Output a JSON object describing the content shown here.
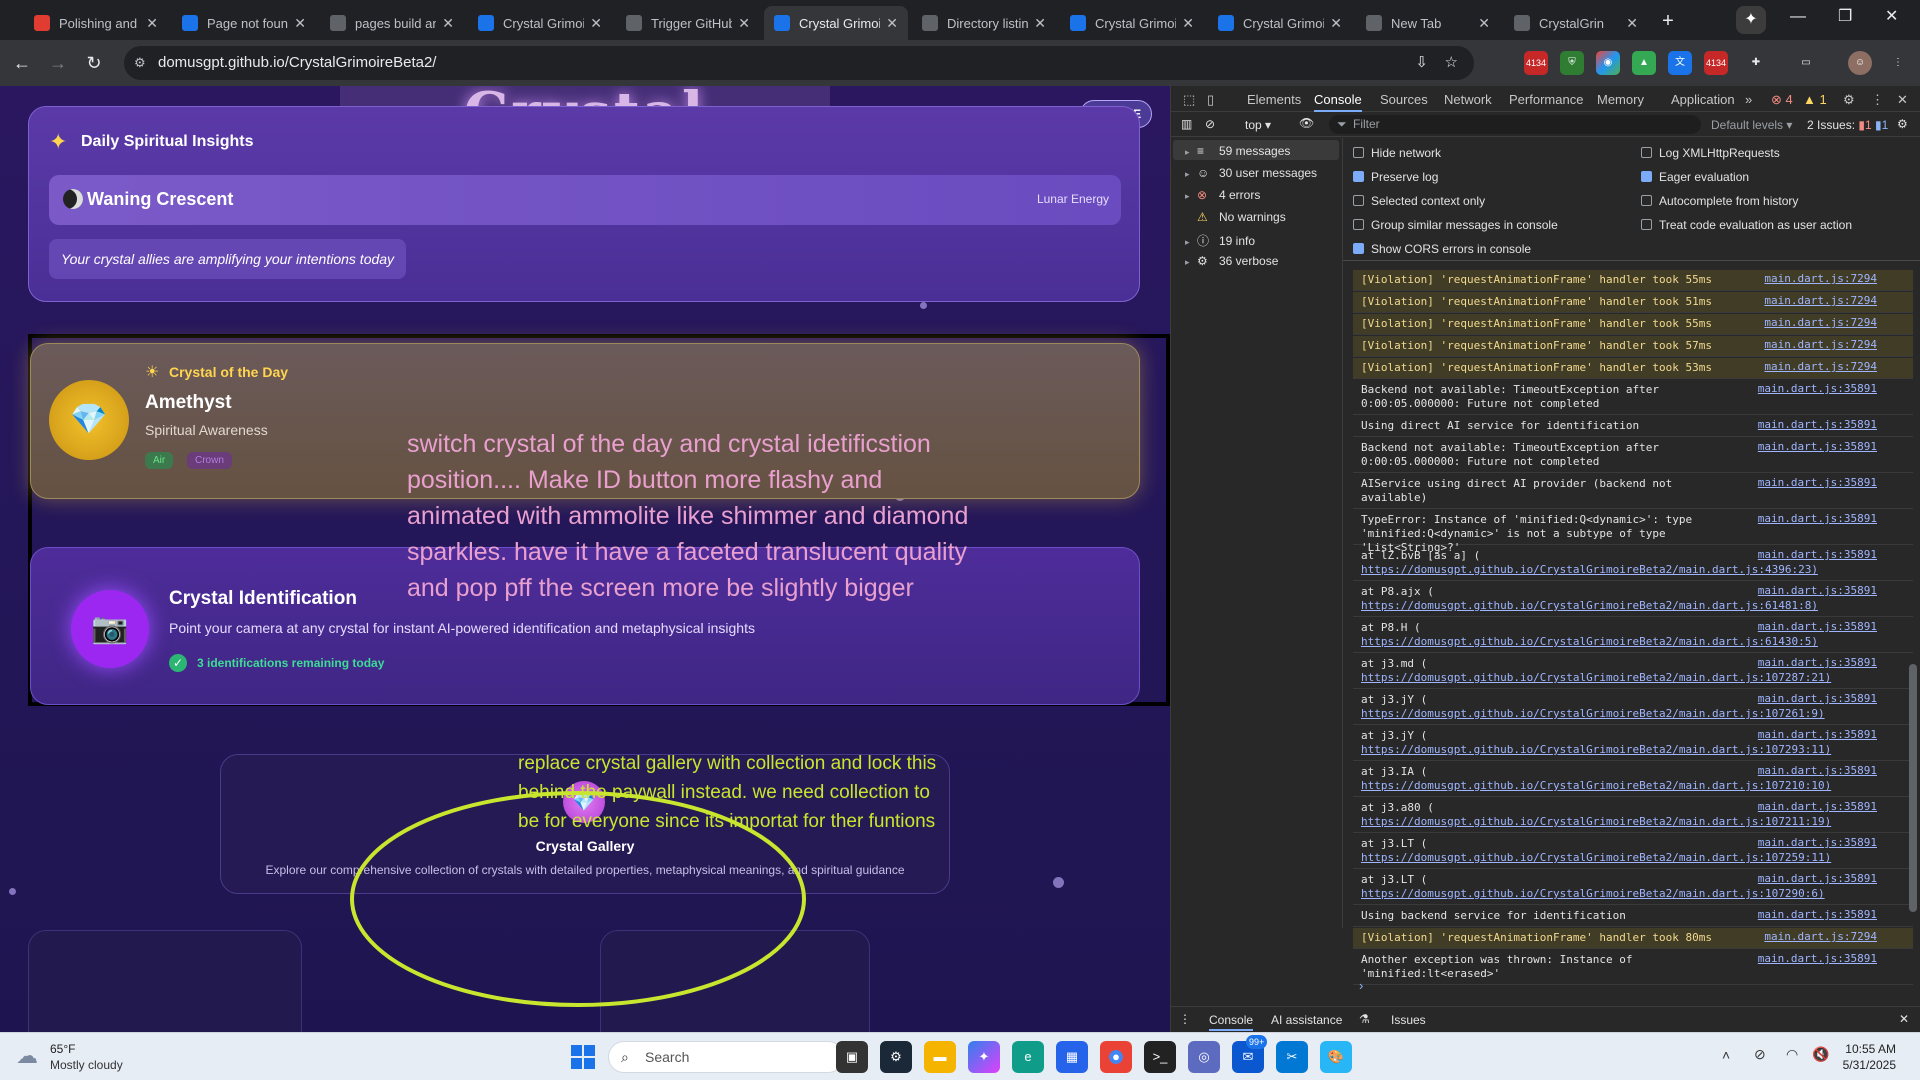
{
  "tabs": [
    {
      "title": "Polishing and I",
      "color": "#e03c31",
      "active": false
    },
    {
      "title": "Page not foun",
      "color": "#1a73e8",
      "active": false
    },
    {
      "title": "pages build an",
      "color": "#5f6368",
      "active": false
    },
    {
      "title": "Crystal Grimoi",
      "color": "#1a73e8",
      "active": false
    },
    {
      "title": "Trigger GitHub",
      "color": "#5f6368",
      "active": false
    },
    {
      "title": "Crystal Grimoi",
      "color": "#1a73e8",
      "active": true
    },
    {
      "title": "Directory listin",
      "color": "#5f6368",
      "active": false
    },
    {
      "title": "Crystal Grimoi",
      "color": "#1a73e8",
      "active": false
    },
    {
      "title": "Crystal Grimoi",
      "color": "#1a73e8",
      "active": false
    },
    {
      "title": "New Tab",
      "color": "#5f6368",
      "active": false
    },
    {
      "title": "CrystalGrin",
      "color": "#5f6368",
      "active": false
    }
  ],
  "address": {
    "url": "domusgpt.github.io/CrystalGrimoireBeta2/",
    "badge_count": "4134"
  },
  "app": {
    "title": "Crystal Grimoire",
    "free_badge": "FREE",
    "insights": {
      "heading": "Daily Spiritual Insights",
      "moon_phase": "Waning Crescent",
      "lunar_label": "Lunar Energy",
      "message": "Your crystal allies are amplifying your intentions today"
    },
    "crystal_of_day": {
      "label": "Crystal of the Day",
      "name": "Amethyst",
      "subtitle": "Spiritual Awareness",
      "tags": [
        "Air",
        "Crown"
      ]
    },
    "identification": {
      "title": "Crystal Identification",
      "description": "Point your camera at any crystal for instant AI-powered identification and metaphysical insights",
      "remaining": "3 identifications remaining today"
    },
    "gallery": {
      "title": "Crystal Gallery",
      "description": "Explore our comprehensive collection of crystals with detailed properties, metaphysical meanings, and spiritual guidance"
    },
    "annotations": {
      "note1": "switch crystal of the day and crystal idetificstion position.... Make ID button more flashy and animated with ammolite like shimmer and diamond sparkles. have it have a faceted translucent quality and pop pff the screen more be slightly bigger",
      "note2": "replace crystal gallery with collection and lock this behind the paywall instead. we need collection to be for everyone since its importat for ther funtions"
    }
  },
  "devtools": {
    "tabs": [
      "Elements",
      "Console",
      "Sources",
      "Network",
      "Performance",
      "Memory",
      "Application"
    ],
    "errors_count": "4",
    "warnings_count": "1",
    "context": "top",
    "filter_placeholder": "Filter",
    "levels": "Default levels",
    "issues": "2 Issues:",
    "issues_err": "1",
    "issues_info": "1",
    "sidebar": [
      {
        "label": "59 messages"
      },
      {
        "label": "30 user messages"
      },
      {
        "label": "4 errors"
      },
      {
        "label": "No warnings"
      },
      {
        "label": "19 info"
      },
      {
        "label": "36 verbose"
      }
    ],
    "settings_left": [
      {
        "label": "Hide network",
        "checked": false
      },
      {
        "label": "Preserve log",
        "checked": true
      },
      {
        "label": "Selected context only",
        "checked": false
      },
      {
        "label": "Group similar messages in console",
        "checked": false
      },
      {
        "label": "Show CORS errors in console",
        "checked": true
      }
    ],
    "settings_right": [
      {
        "label": "Log XMLHttpRequests",
        "checked": false
      },
      {
        "label": "Eager evaluation",
        "checked": true
      },
      {
        "label": "Autocomplete from history",
        "checked": false
      },
      {
        "label": "Treat code evaluation as user action",
        "checked": false
      }
    ],
    "logs": [
      {
        "type": "warn",
        "text": "[Violation] 'requestAnimationFrame' handler took 55ms",
        "src": "main.dart.js:7294"
      },
      {
        "type": "warn",
        "text": "[Violation] 'requestAnimationFrame' handler took 51ms",
        "src": "main.dart.js:7294"
      },
      {
        "type": "warn",
        "text": "[Violation] 'requestAnimationFrame' handler took 55ms",
        "src": "main.dart.js:7294"
      },
      {
        "type": "warn",
        "text": "[Violation] 'requestAnimationFrame' handler took 57ms",
        "src": "main.dart.js:7294"
      },
      {
        "type": "warn",
        "text": "[Violation] 'requestAnimationFrame' handler took 53ms",
        "src": "main.dart.js:7294"
      },
      {
        "type": "info",
        "text": "Backend not available: TimeoutException after 0:00:05.000000: Future not completed",
        "src": "main.dart.js:35891"
      },
      {
        "type": "info",
        "text": "Using direct AI service for identification",
        "src": "main.dart.js:35891"
      },
      {
        "type": "info",
        "text": "Backend not available: TimeoutException after 0:00:05.000000: Future not completed",
        "src": "main.dart.js:35891"
      },
      {
        "type": "info",
        "text": "AIService using direct AI provider (backend not available)",
        "src": "main.dart.js:35891"
      },
      {
        "type": "info",
        "text": "TypeError: Instance of 'minified:Q<dynamic>': type 'minified:Q<dynamic>' is not a subtype of type 'List<String>?'",
        "src": "main.dart.js:35891"
      },
      {
        "type": "info",
        "text": "at lZ.bvB [as a] (",
        "url": "https://domusgpt.github.io/CrystalGrimoireBeta2/main.dart.js:4396:23)",
        "src": "main.dart.js:35891"
      },
      {
        "type": "info",
        "text": "    at P8.ajx (",
        "url": "https://domusgpt.github.io/CrystalGrimoireBeta2/main.dart.js:61481:8)",
        "src": "main.dart.js:35891"
      },
      {
        "type": "info",
        "text": "    at P8.H (",
        "url": "https://domusgpt.github.io/CrystalGrimoireBeta2/main.dart.js:61430:5)",
        "src": "main.dart.js:35891"
      },
      {
        "type": "info",
        "text": "    at j3.md (",
        "url": "https://domusgpt.github.io/CrystalGrimoireBeta2/main.dart.js:107287:21)",
        "src": "main.dart.js:35891"
      },
      {
        "type": "info",
        "text": "    at j3.jY (",
        "url": "https://domusgpt.github.io/CrystalGrimoireBeta2/main.dart.js:107261:9)",
        "src": "main.dart.js:35891"
      },
      {
        "type": "info",
        "text": "    at j3.jY (",
        "url": "https://domusgpt.github.io/CrystalGrimoireBeta2/main.dart.js:107293:11)",
        "src": "main.dart.js:35891"
      },
      {
        "type": "info",
        "text": "    at j3.IA (",
        "url": "https://domusgpt.github.io/CrystalGrimoireBeta2/main.dart.js:107210:10)",
        "src": "main.dart.js:35891"
      },
      {
        "type": "info",
        "text": "    at j3.a80 (",
        "url": "https://domusgpt.github.io/CrystalGrimoireBeta2/main.dart.js:107211:19)",
        "src": "main.dart.js:35891"
      },
      {
        "type": "info",
        "text": "    at j3.LT (",
        "url": "https://domusgpt.github.io/CrystalGrimoireBeta2/main.dart.js:107259:11)",
        "src": "main.dart.js:35891"
      },
      {
        "type": "info",
        "text": "    at j3.LT (",
        "url": "https://domusgpt.github.io/CrystalGrimoireBeta2/main.dart.js:107290:6)",
        "src": "main.dart.js:35891"
      },
      {
        "type": "info",
        "text": "Using backend service for identification",
        "src": "main.dart.js:35891"
      },
      {
        "type": "warn",
        "text": "[Violation] 'requestAnimationFrame' handler took 80ms",
        "src": "main.dart.js:7294"
      },
      {
        "type": "info",
        "text": "Another exception was thrown: Instance of 'minified:lt<erased>'",
        "src": "main.dart.js:35891"
      }
    ],
    "bottom_tabs": [
      "Console",
      "AI assistance",
      "Issues"
    ]
  },
  "taskbar": {
    "weather_temp": "65°F",
    "weather_desc": "Mostly cloudy",
    "search_placeholder": "Search",
    "time": "10:55 AM",
    "date": "5/31/2025",
    "mail_badge": "99+"
  }
}
